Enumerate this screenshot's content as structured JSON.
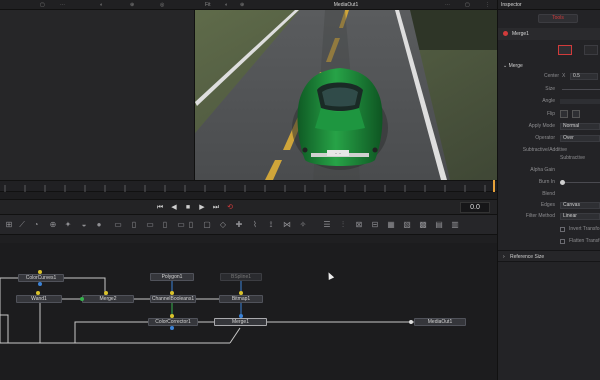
{
  "viewer": {
    "title": "MediaOut1",
    "zoom_label": "Fit",
    "left_tools": [
      "▢",
      "⋯",
      "◐",
      "⊕",
      "◎"
    ],
    "right_tools": [
      "◐",
      "⊕",
      "⋯",
      "▢",
      "⋮"
    ]
  },
  "transport": {
    "buttons": [
      "⏮",
      "◀",
      "■",
      "▶",
      "⏭",
      "⟲"
    ],
    "time": "0.0"
  },
  "node_toolbar": {
    "tools": [
      "⊞",
      "⟋",
      "◔",
      "⊕",
      "✦",
      "◒",
      "●",
      "◆",
      "▭",
      "▯",
      "▭",
      "▯",
      "▭",
      "▯",
      "▢",
      "◇",
      "✚",
      "⌇",
      "⟟",
      "⋈",
      "✧",
      "☰",
      "⫶",
      "⊠",
      "⊟",
      "▦",
      "▧",
      "▩",
      "▤",
      "▥"
    ]
  },
  "nodes": {
    "colorcurves": "ColorCurves1",
    "polygon": "Polygon1",
    "bspline": "BSpline1",
    "wand": "Wand1",
    "merge2": "Merge2",
    "channelbooleans": "ChannelBooleans1",
    "bitmap": "Bitmap1",
    "colorcorrector": "ColorCorrector1",
    "merge1": "Merge1",
    "mediaout": "MediaOut1"
  },
  "inspector": {
    "title": "Inspector",
    "tab_tools": "Tools",
    "node_name": "Merge1",
    "section_merge": "Merge",
    "center_label": "Center",
    "center_x_label": "X",
    "center_x": "0.5",
    "size_label": "Size",
    "angle_label": "Angle",
    "flip_label": "Flip",
    "apply_mode_label": "Apply Mode",
    "apply_mode": "Normal",
    "operator_label": "Operator",
    "operator": "Over",
    "subtractive_additive_label": "Subtractive/Additive",
    "subtractive_label": "Subtractive",
    "alpha_gain_label": "Alpha Gain",
    "burn_in_label": "Burn In",
    "blend_label": "Blend",
    "edges_label": "Edges",
    "edges": "Canvas",
    "filter_method_label": "Filter Method",
    "filter_method": "Linear",
    "invert_transform_label": "Invert Transform",
    "flatten_transform_label": "Flatten Transform",
    "reference_size": "Reference Size"
  },
  "colors": {
    "accent_red": "#d23b3b",
    "playhead_orange": "#e7a23a",
    "car_green": "#1f8a3a",
    "port_yellow": "#d9c22b",
    "port_green": "#37b24d",
    "port_blue": "#3b82d6"
  }
}
